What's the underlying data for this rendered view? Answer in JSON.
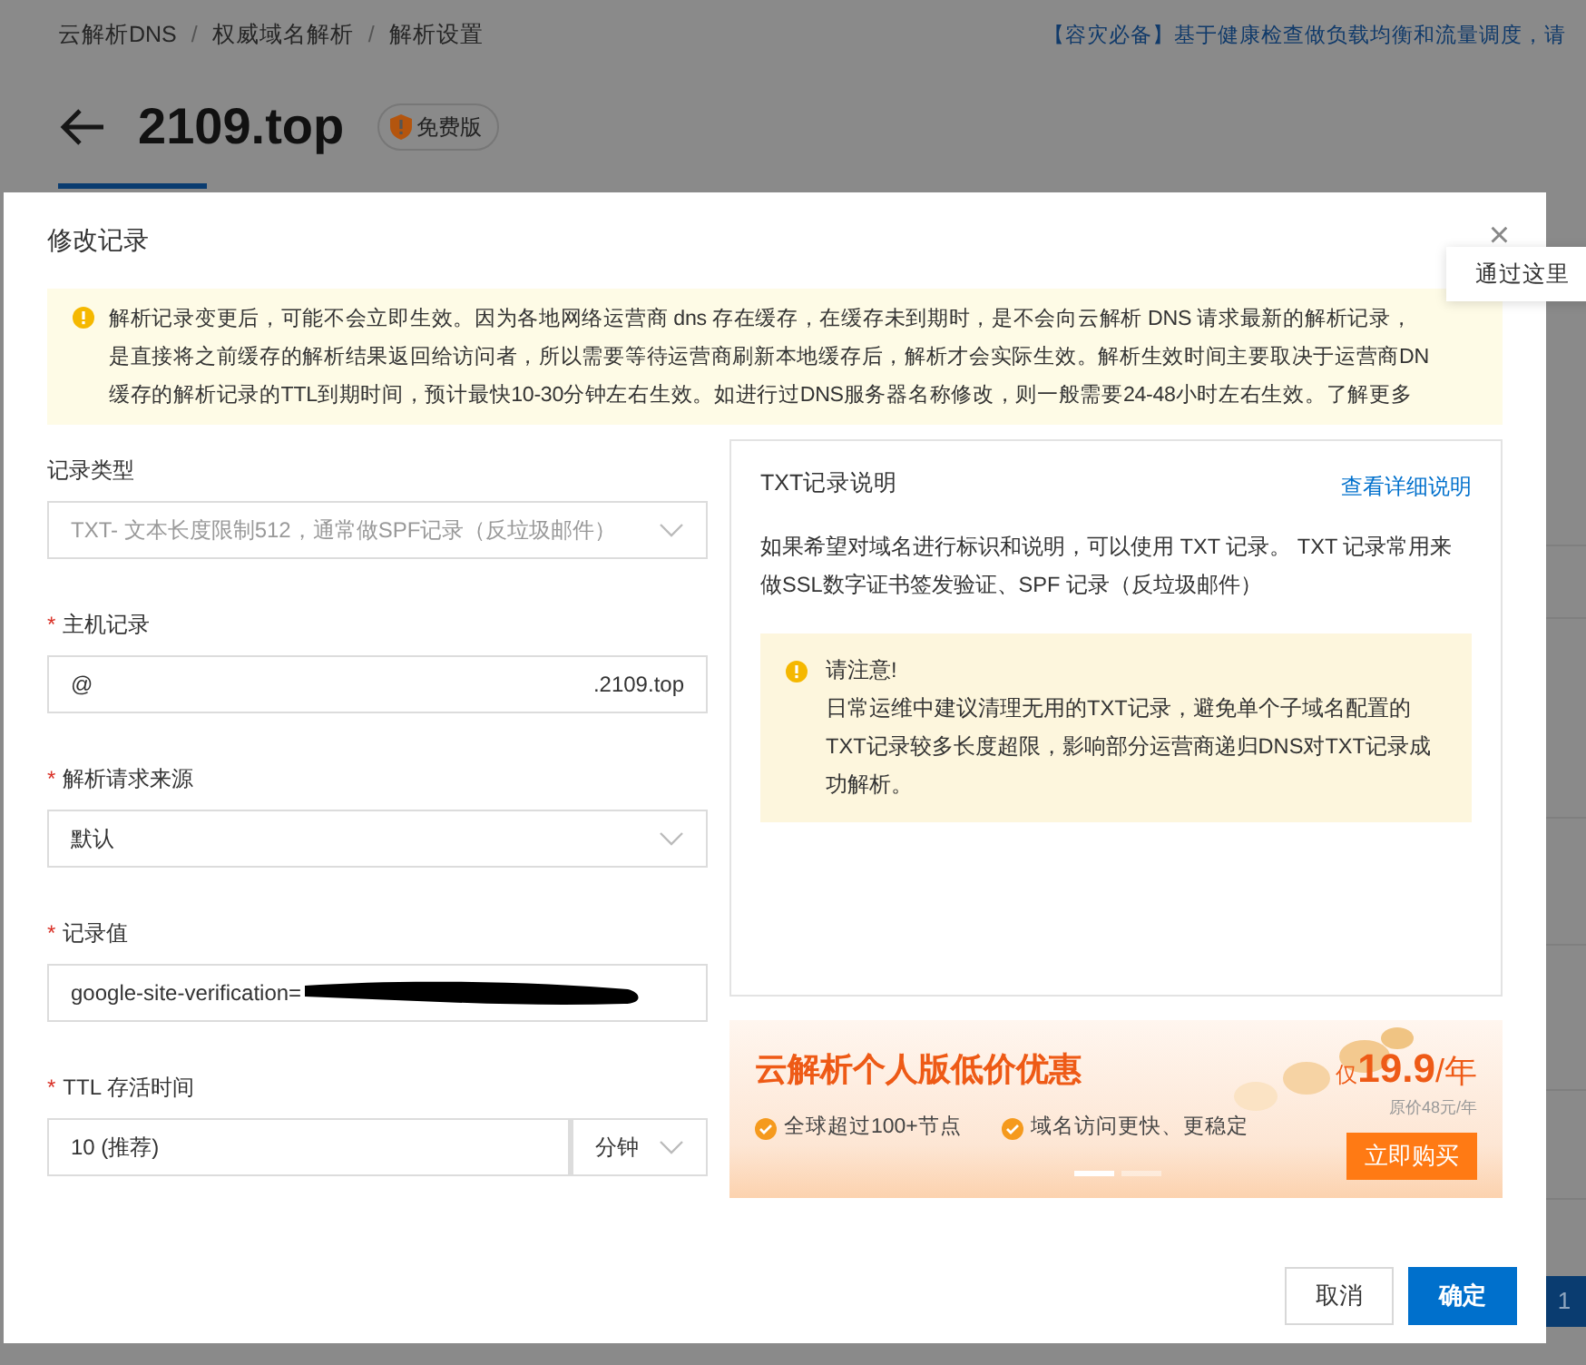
{
  "background": {
    "breadcrumb": [
      "云解析DNS",
      "权威域名解析",
      "解析设置"
    ],
    "breadcrumb_separator": "/",
    "promo_link": "【容灾必备】基于健康检查做负载均衡和流量调度，请",
    "domain": "2109.top",
    "plan_badge": "免费版",
    "pagination": [
      "1"
    ]
  },
  "tooltip": {
    "text": "通过这里"
  },
  "dialog": {
    "title": "修改记录",
    "close": "×",
    "required_mark": "*",
    "notice": {
      "lines": [
        "解析记录变更后，可能不会立即生效。因为各地网络运营商 dns 存在缓存，在缓存未到期时，是不会向云解析 DNS 请求最新的解析记录，",
        "是直接将之前缓存的解析结果返回给访问者，所以需要等待运营商刷新本地缓存后，解析才会实际生效。解析生效时间主要取决于运营商DN",
        "缓存的解析记录的TTL到期时间，预计最快10-30分钟左右生效。如进行过DNS服务器名称修改，则一般需要24-48小时左右生效。"
      ],
      "link": "了解更多"
    },
    "fields": [
      {
        "kind": "select",
        "label": "记录类型",
        "required": false,
        "value": "TXT- 文本长度限制512，通常做SPF记录（反垃圾邮件）",
        "disabled": true
      },
      {
        "kind": "input",
        "label": "主机记录",
        "required": true,
        "value": "@",
        "suffix": ".2109.top"
      },
      {
        "kind": "select",
        "label": "解析请求来源",
        "required": true,
        "value": "默认",
        "disabled": false
      },
      {
        "kind": "input",
        "label": "记录值",
        "required": true,
        "value": "google-site-verification=",
        "redacted": true
      },
      {
        "kind": "ttl",
        "label": "TTL  存活时间",
        "required": true,
        "value": "10 (推荐)",
        "unit": "分钟"
      }
    ],
    "help": {
      "title": "TXT记录说明",
      "link": "查看详细说明",
      "text": "如果希望对域名进行标识和说明，可以使用 TXT 记录。 TXT 记录常用来做SSL数字证书签发验证、SPF 记录（反垃圾邮件）",
      "warning_title": "请注意!",
      "warning_text": "日常运维中建议清理无用的TXT记录，避免单个子域名配置的TXT记录较多长度超限，影响部分运营商递归DNS对TXT记录成功解析。"
    },
    "banner": {
      "title": "云解析个人版低价优惠",
      "price_prefix": "仅",
      "price": "19.9",
      "price_unit": "/年",
      "original_price": "原价48元/年",
      "features": [
        "全球超过100+节点",
        "域名访问更快、更稳定"
      ],
      "button": "立即购买",
      "dots": [
        {
          "selected": true
        },
        {
          "selected": false
        }
      ]
    },
    "buttons": [
      {
        "label": "取消",
        "kind": "secondary"
      },
      {
        "label": "确定",
        "kind": "primary"
      }
    ]
  }
}
